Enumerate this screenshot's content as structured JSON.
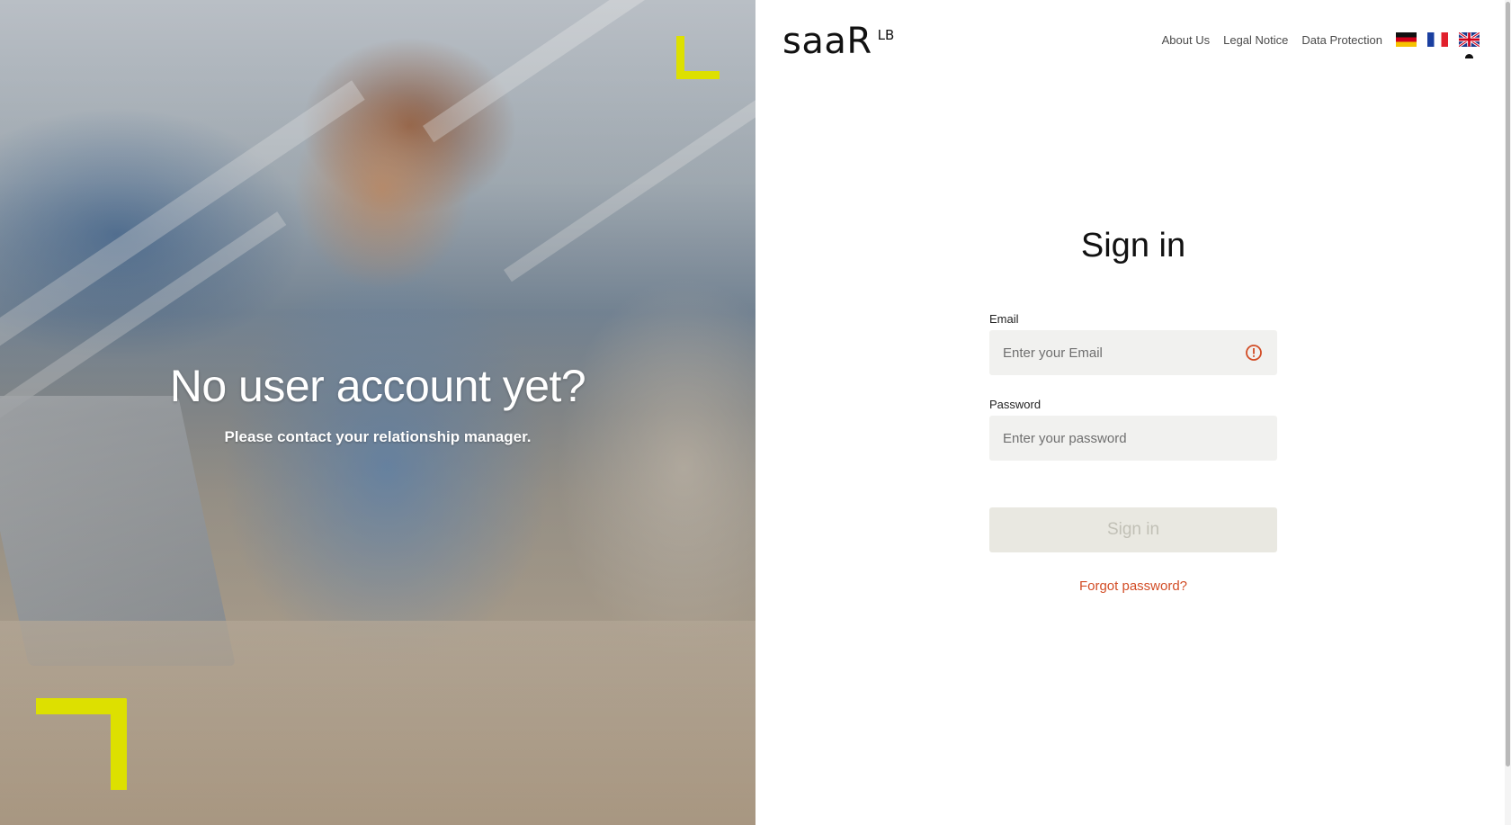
{
  "hero": {
    "title": "No user account yet?",
    "subtitle": "Please contact your relationship manager.",
    "accent_color": "#dde000"
  },
  "header": {
    "logo_main": "saaR",
    "logo_sup": "LB",
    "nav": [
      "About Us",
      "Legal Notice",
      "Data Protection"
    ],
    "languages": [
      {
        "icon": "flag-germany-icon",
        "code": "de"
      },
      {
        "icon": "flag-france-icon",
        "code": "fr"
      },
      {
        "icon": "flag-uk-icon",
        "code": "en",
        "active": true
      }
    ]
  },
  "signin": {
    "title": "Sign in",
    "email": {
      "label": "Email",
      "placeholder": "Enter your Email",
      "value": "",
      "status_icon": "warning-circle-icon",
      "status_color": "#d24c25"
    },
    "password": {
      "label": "Password",
      "placeholder": "Enter your password",
      "value": ""
    },
    "submit_label": "Sign in",
    "submit_disabled": true,
    "forgot_label": "Forgot password?",
    "link_color": "#d24c25"
  }
}
